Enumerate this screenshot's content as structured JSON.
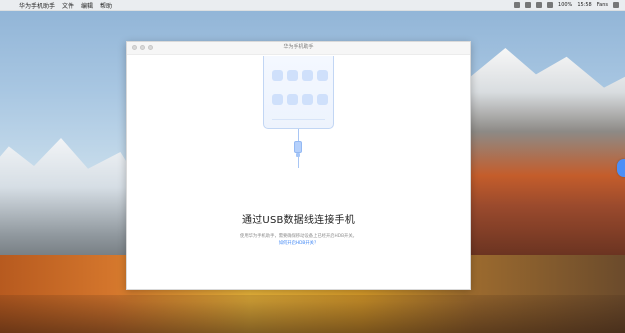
{
  "menu_bar": {
    "app_name": "华为手机助手",
    "items": [
      "文件",
      "编辑",
      "帮助"
    ],
    "right": {
      "status_text": "100%",
      "time": "15:58",
      "user": "Fans"
    }
  },
  "window": {
    "title": "华为手机助手"
  },
  "content": {
    "heading": "通过USB数据线连接手机",
    "description": "使用华为手机助手，需要确保移动设备上已经开启HDB开关。",
    "link_text": "如何开启HDB开关？"
  },
  "colors": {
    "accent": "#3e86f5",
    "window_bg": "#ffffff",
    "phone_fill": "#edf3fd"
  },
  "icons": {
    "menu_apple": "apple-icon",
    "phone": "phone-illustration-icon",
    "usb": "usb-cable-icon",
    "side_tab": "floating-tab-icon"
  }
}
